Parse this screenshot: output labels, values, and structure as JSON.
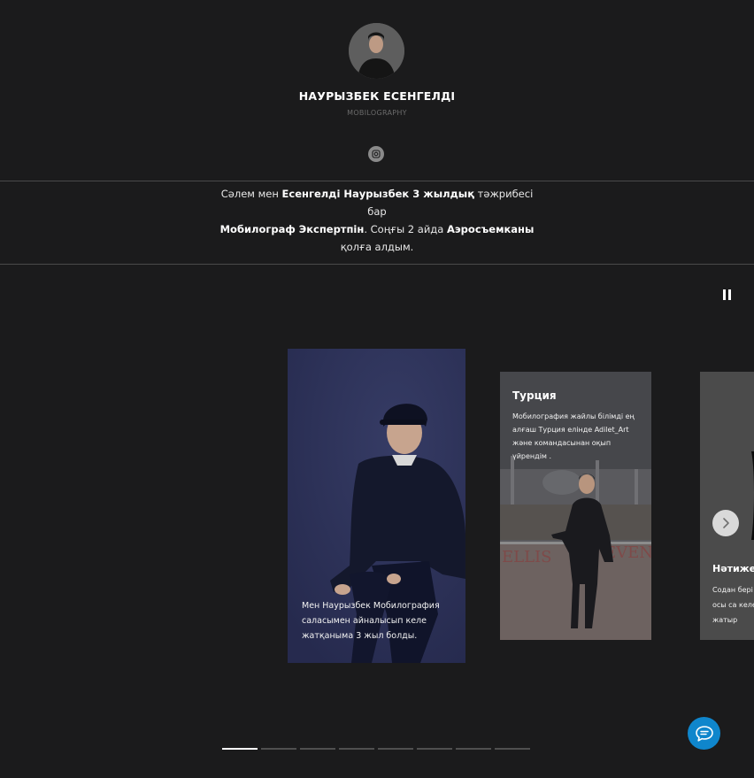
{
  "profile": {
    "name": "НАУРЫЗБЕК ЕСЕНГЕЛДІ",
    "role": "MOBILOGRAPHY",
    "social_icon": "instagram-icon"
  },
  "bio": {
    "parts": [
      {
        "text": "Сәлем мен ",
        "bold": false
      },
      {
        "text": "Есенгелді Наурызбек 3 жылдық",
        "bold": true
      },
      {
        "text": " тәжрибесі бар ",
        "bold": false
      },
      {
        "text": "Мобилограф Экспертпін",
        "bold": true
      },
      {
        "text": ". Соңғы 2 айда ",
        "bold": false
      },
      {
        "text": "Аэросъемканы",
        "bold": true
      },
      {
        "text": " қолға алдым.",
        "bold": false
      }
    ]
  },
  "carousel": {
    "pause_icon": "pause-icon",
    "next_icon": "chevron-right-icon",
    "slides": [
      {
        "title": "",
        "text": "Мен Наурызбек Мобилография саласымен айналысып келе жатқаныма 3 жыл болды."
      },
      {
        "title": "Турция",
        "text": "Мобилография жайлы білімді ең алғаш Турция елінде Adilet_Art және командасынан оқып үйрендім ."
      },
      {
        "title": "Нәтижел",
        "text": "Содан бері енің, осы са келе жатыр"
      }
    ],
    "progress": {
      "total": 8,
      "active": 1
    }
  },
  "chat": {
    "icon": "chat-bubble-icon"
  },
  "colors": {
    "background": "#1b1b1c",
    "chat_button": "#0f86cc",
    "divider": "#4a4a4a"
  }
}
